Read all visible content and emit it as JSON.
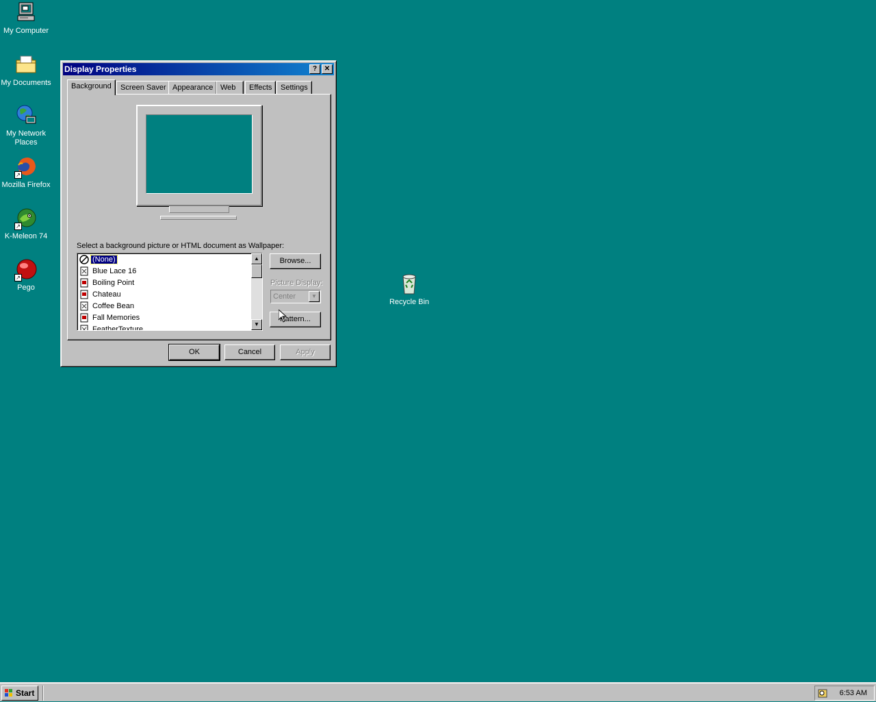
{
  "desktop": {
    "icons": [
      {
        "label": "My Computer",
        "icon": "my-computer-icon"
      },
      {
        "label": "My Documents",
        "icon": "folder-icon"
      },
      {
        "label": "My Network Places",
        "icon": "network-places-icon"
      },
      {
        "label": "Mozilla Firefox",
        "icon": "firefox-icon"
      },
      {
        "label": "K-Meleon 74",
        "icon": "k-meleon-icon"
      },
      {
        "label": "Pego",
        "icon": "pego-icon"
      }
    ],
    "recycle_bin": {
      "label": "Recycle Bin",
      "icon": "recycle-bin-icon"
    },
    "background_color": "#008080"
  },
  "window": {
    "title": "Display Properties",
    "help_button": "?",
    "close_button": "✕",
    "tabs": [
      {
        "label": "Background",
        "active": true
      },
      {
        "label": "Screen Saver"
      },
      {
        "label": "Appearance"
      },
      {
        "label": "Web"
      },
      {
        "label": "Effects"
      },
      {
        "label": "Settings"
      }
    ],
    "wallpaper_prompt": "Select a background picture or HTML document as Wallpaper:",
    "wallpapers": [
      {
        "label": "(None)",
        "icon": "none-icon",
        "selected": true
      },
      {
        "label": "Blue Lace 16",
        "icon": "bitmap-file-icon"
      },
      {
        "label": "Boiling Point",
        "icon": "html-file-icon"
      },
      {
        "label": "Chateau",
        "icon": "html-file-icon"
      },
      {
        "label": "Coffee Bean",
        "icon": "bitmap-file-icon"
      },
      {
        "label": "Fall Memories",
        "icon": "html-file-icon"
      },
      {
        "label": "FeatherTexture",
        "icon": "bitmap-file-icon"
      }
    ],
    "browse_button": "Browse...",
    "picture_display_label": "Picture Display:",
    "picture_display_value": "Center",
    "pattern_button": "Pattern...",
    "ok_button": "OK",
    "cancel_button": "Cancel",
    "apply_button": "Apply"
  },
  "taskbar": {
    "start_label": "Start",
    "clock": "6:53 AM"
  }
}
